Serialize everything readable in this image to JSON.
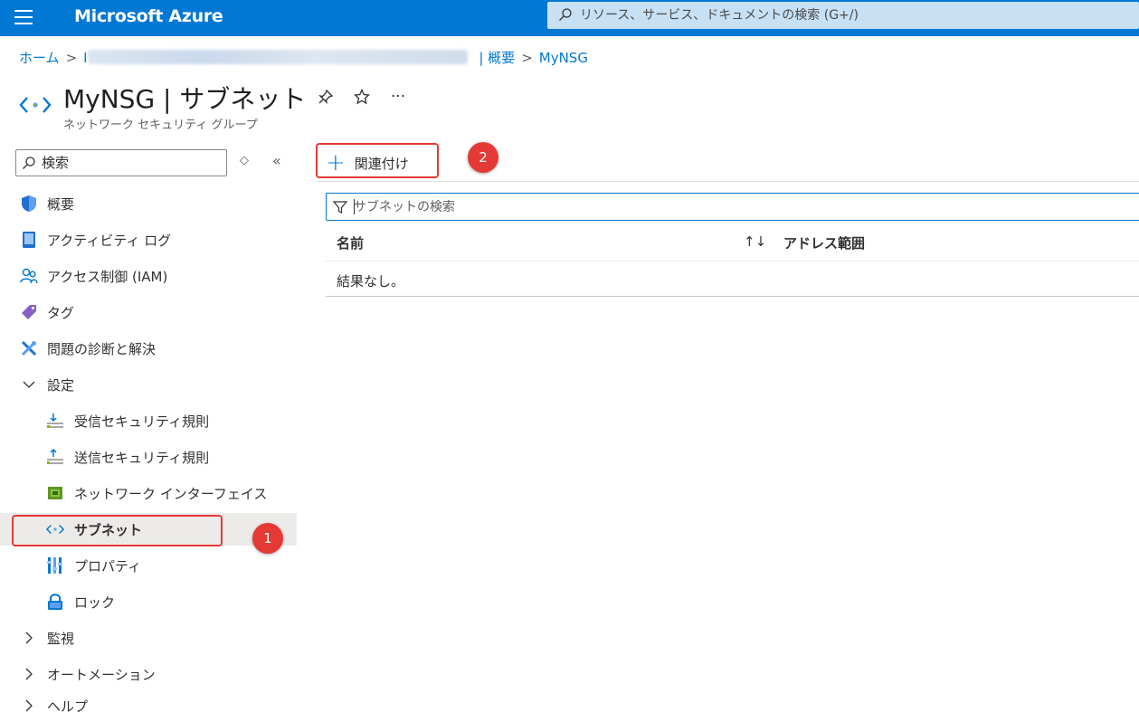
{
  "topbar": {
    "brand": "Microsoft Azure",
    "search_placeholder": "リソース、サービス、ドキュメントの検索 (G+/)"
  },
  "breadcrumb": {
    "home": "ホーム",
    "middle_prefix": "I",
    "overview": "| 概要",
    "current": "MyNSG"
  },
  "header": {
    "title": "MyNSG | サブネット",
    "subtitle": "ネットワーク セキュリティ グループ",
    "more": "···"
  },
  "sidebar": {
    "search_placeholder": "検索",
    "items": [
      {
        "label": "概要",
        "icon": "shield-icon"
      },
      {
        "label": "アクティビティ ログ",
        "icon": "activity-log-icon"
      },
      {
        "label": "アクセス制御 (IAM)",
        "icon": "people-icon"
      },
      {
        "label": "タグ",
        "icon": "tag-icon"
      },
      {
        "label": "問題の診断と解決",
        "icon": "wrench-icon"
      },
      {
        "label": "設定",
        "icon": "chevron-down-icon"
      },
      {
        "label": "受信セキュリティ規則",
        "icon": "inbound-rules-icon"
      },
      {
        "label": "送信セキュリティ規則",
        "icon": "outbound-rules-icon"
      },
      {
        "label": "ネットワーク インターフェイス",
        "icon": "network-interface-icon"
      },
      {
        "label": "サブネット",
        "icon": "subnet-icon"
      },
      {
        "label": "プロパティ",
        "icon": "properties-icon"
      },
      {
        "label": "ロック",
        "icon": "lock-icon"
      },
      {
        "label": "監視",
        "icon": "chevron-right-icon"
      },
      {
        "label": "オートメーション",
        "icon": "chevron-right-icon"
      },
      {
        "label": "ヘルプ",
        "icon": "chevron-right-icon"
      }
    ]
  },
  "annotations": {
    "badge_1": "1",
    "badge_2": "2"
  },
  "main": {
    "associate_label": "関連付け",
    "filter_placeholder": "サブネットの検索",
    "columns": [
      "名前",
      "アドレス範囲"
    ],
    "sort_glyph": "↑↓",
    "empty_text": "結果なし。"
  },
  "colors": {
    "accent": "#0078d4",
    "annotation_red": "#e53935",
    "selected_bg": "#edebe9"
  }
}
